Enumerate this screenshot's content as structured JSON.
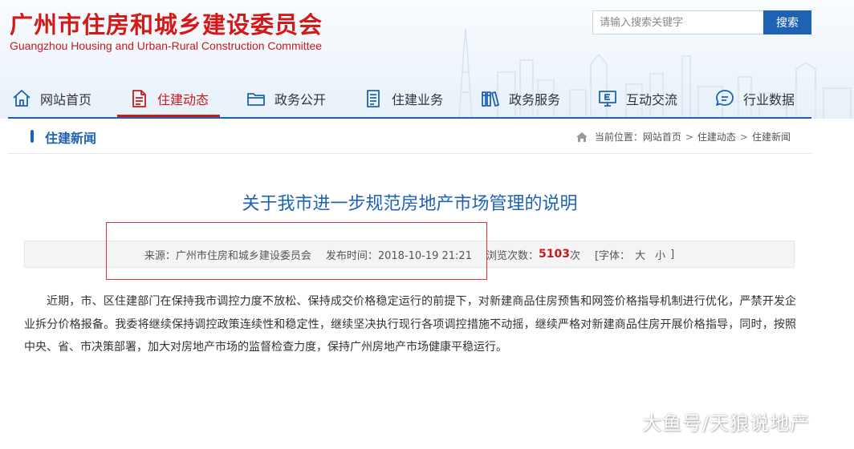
{
  "header": {
    "title": "广州市住房和城乡建设委员会",
    "subtitle": "Guangzhou Housing and Urban-Rural Construction Committee",
    "search_placeholder": "请输入搜索关键字",
    "search_button": "搜索"
  },
  "nav": {
    "items": [
      {
        "label": "网站首页",
        "icon": "home-icon"
      },
      {
        "label": "住建动态",
        "icon": "document-icon",
        "active": true
      },
      {
        "label": "政务公开",
        "icon": "folder-icon"
      },
      {
        "label": "住建业务",
        "icon": "clipboard-icon"
      },
      {
        "label": "政务服务",
        "icon": "books-icon"
      },
      {
        "label": "互动交流",
        "icon": "monitor-e-icon"
      },
      {
        "label": "行业数据",
        "icon": "chat-bubble-icon"
      }
    ]
  },
  "section": {
    "title": "住建新闻",
    "breadcrumb": {
      "prefix": "当前位置：",
      "items": [
        "网站首页",
        "住建动态",
        "住建新闻"
      ],
      "separator": ">"
    }
  },
  "article": {
    "title": "关于我市进一步规范房地产市场管理的说明",
    "meta": {
      "source": "来源：广州市住房和城乡建设委员会",
      "published": "发布时间：2018-10-19 21:21",
      "views_label": "浏览次数：",
      "views": "5103",
      "views_unit": "次",
      "font_label": "[字体：",
      "font_large": "大",
      "font_small": "小",
      "font_close": "]"
    },
    "body": "近期，市、区住建部门在保持我市调控力度不放松、保持成交价格稳定运行的前提下，对新建商品住房预售和网签价格指导机制进行优化，严禁开发企业拆分价格报备。我委将继续保持调控政策连续性和稳定性，继续坚决执行现行各项调控措施不动摇，继续严格对新建商品住房开展价格指导，同时，按照中央、省、市决策部署，加大对房地产市场的监督检查力度，保持广州房地产市场健康平稳运行。"
  },
  "watermark": "大鱼号/天狼说地产",
  "colors": {
    "brand_red": "#c8191e",
    "brand_blue": "#1e62b4",
    "highlight_frame": "#d9363e"
  }
}
